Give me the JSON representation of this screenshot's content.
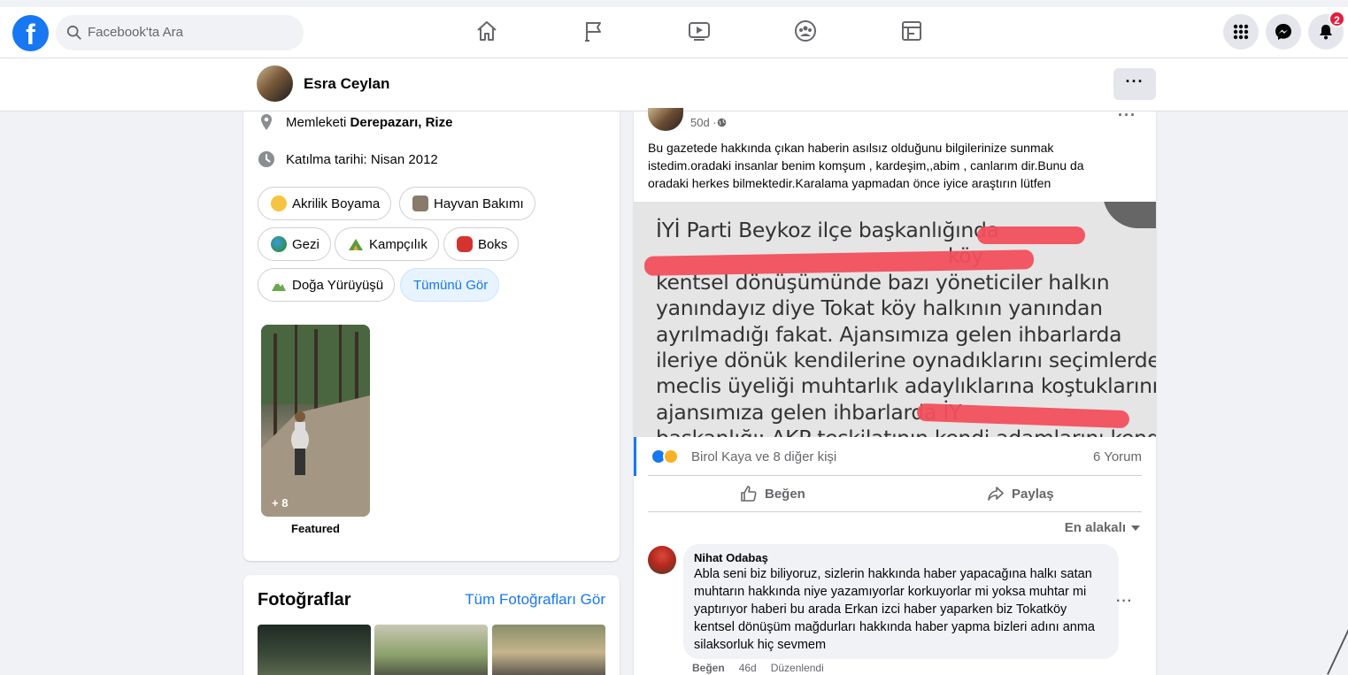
{
  "topbar": {
    "logo": "f",
    "search_placeholder": "Facebook'ta Ara",
    "notification_count": "2",
    "nav_icons": [
      "home-icon",
      "pages-flag-icon",
      "watch-icon",
      "groups-icon",
      "gaming-icon"
    ]
  },
  "profile_bar": {
    "name": "Esra Ceylan",
    "more_label": "···"
  },
  "intro": {
    "hometown_prefix": "Memleketi ",
    "hometown": "Derepazarı, Rize",
    "joined": "Katılma tarihi: Nisan 2012",
    "hobbies": [
      {
        "label": "Akrilik Boyama",
        "color": "#f5c542"
      },
      {
        "label": "Hayvan Bakımı",
        "color": "#8a7a6a"
      },
      {
        "label": "Gezi",
        "color": "#2f8f4e"
      },
      {
        "label": "Kampçılık",
        "color": "#e6a93a"
      },
      {
        "label": "Boks",
        "color": "#d6322e"
      },
      {
        "label": "Doğa Yürüyüşü",
        "color": "#6aa84f"
      }
    ],
    "see_all": "Tümünü Gör",
    "featured_count": "+ 8",
    "featured_label": "Featured"
  },
  "photos": {
    "title": "Fotoğraflar",
    "see_all": "Tüm Fotoğrafları Gör"
  },
  "post": {
    "time": "50d · ",
    "more": "···",
    "text": "Bu gazetede hakkında çıkan haberin asılsız olduğunu bilgilerinize sunmak istedim.oradaki insanlar benim komşum , kardeşim,,abim , canlarım dir.Bunu da oradaki herkes bilmektedir.Karalama yapmadan önce iyice araştırın lütfen",
    "image_lines": [
      "İYİ Parti Beykoz ilçe başkanlığında",
      "                                              köy",
      "kentsel dönüşümünde bazı yöneticiler halkın",
      "yanındayız diye Tokat köy halkının yanından",
      "ayrılmadığı fakat. Ajansımıza gelen ihbarlarda",
      "ileriye dönük kendilerine oynadıklarını seçimlerde",
      "meclis üyeliği muhtarlık  adaylıklarına koştuklarını",
      "ajansımıza gelen ihbarlarda İY",
      "başkanlığı: AKP teşkilatının kendi adamlarını kendi"
    ],
    "reactions_text": "Birol Kaya ve 8 diğer kişi",
    "comments_count": "6 Yorum",
    "like_label": "Beğen",
    "share_label": "Paylaş",
    "sort_label": "En alakalı"
  },
  "comment": {
    "author": "Nihat Odabaş",
    "text": "Abla seni biz biliyoruz, sizlerin hakkında haber yapacağına halkı satan muhtarın hakkında niye yazamıyorlar korkuyorlar mi yoksa muhtar mi yaptırıyor haberi bu arada Erkan izci haber yaparken biz Tokatköy kentsel dönüşüm mağdurları hakkında haber yapma bizleri adını anma silaksorluk hiç sevmem",
    "like": "Beğen",
    "age": "46d",
    "edited": "Düzenlendi",
    "more": "···"
  },
  "colors": {
    "brand": "#1877f2",
    "background": "#f0f2f5",
    "badge": "#e41e3f",
    "redaction": "#f24f5d"
  }
}
